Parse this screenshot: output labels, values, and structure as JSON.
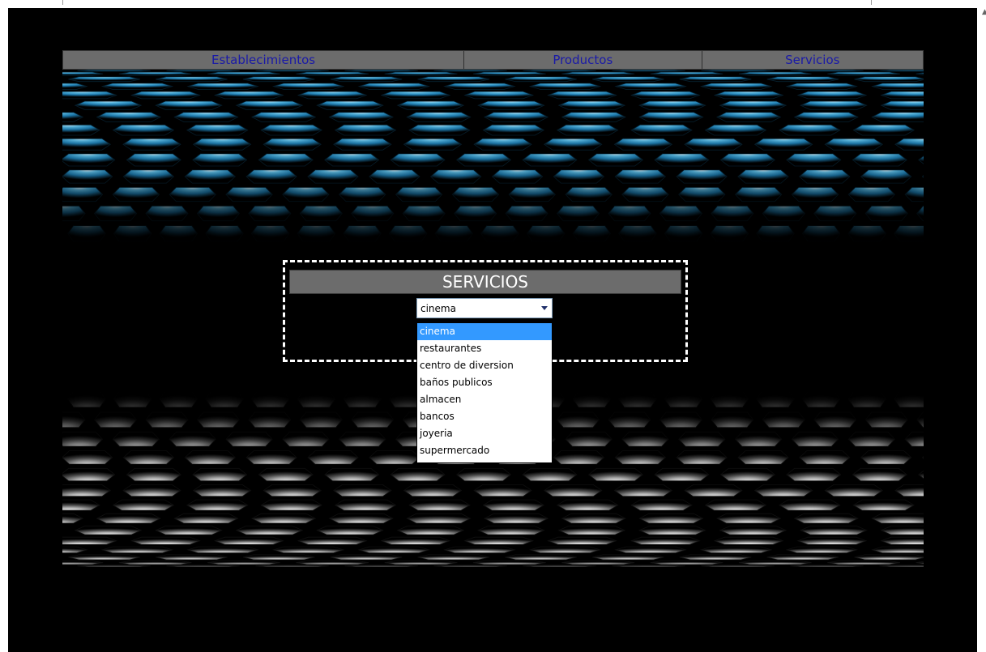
{
  "nav": {
    "items": [
      "Establecimientos",
      "Productos",
      "Servicios"
    ],
    "text_color": "#1a1aa8",
    "bar_color": "#6c6c6c"
  },
  "services": {
    "title": "SERVICIOS",
    "select": {
      "value": "cinema",
      "options": [
        "cinema",
        "restaurantes",
        "centro de diversion",
        "baños publicos",
        "almacen",
        "bancos",
        "joyeria",
        "supermercado"
      ],
      "highlighted_index": 0,
      "highlight_color": "#3399ff"
    }
  },
  "colors": {
    "background": "#000000",
    "hero_top": "#2a9fd6",
    "hero_bottom": "#e6e6e6"
  }
}
